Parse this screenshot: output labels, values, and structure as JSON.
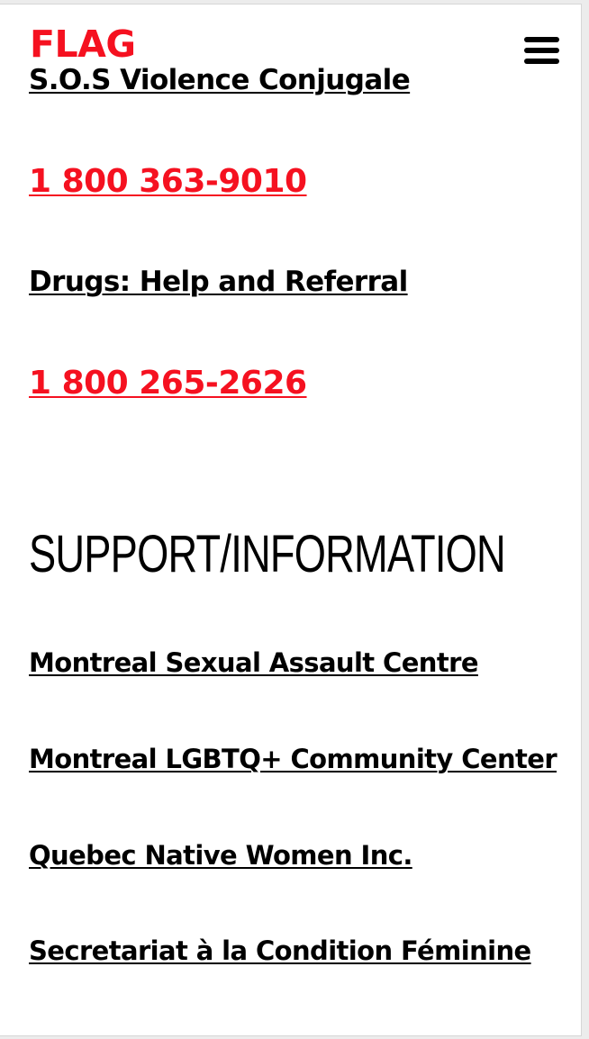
{
  "header": {
    "logo": "FLAG",
    "menu_icon": "hamburger-menu-icon"
  },
  "hotlines": [
    {
      "name": "S.O.S Violence Conjugale",
      "phone": "1 800 363-9010"
    },
    {
      "name": "Drugs: Help and Referral",
      "phone": "1 800 265-2626"
    }
  ],
  "support": {
    "title": "SUPPORT/INFORMATION",
    "links": [
      "Montreal Sexual Assault Centre",
      "Montreal LGBTQ+ Community Center",
      "Quebec Native Women Inc.",
      "Secretariat à la Condition Féminine"
    ]
  },
  "colors": {
    "brand_red": "#f51120",
    "text": "#000000",
    "background": "#ffffff"
  }
}
